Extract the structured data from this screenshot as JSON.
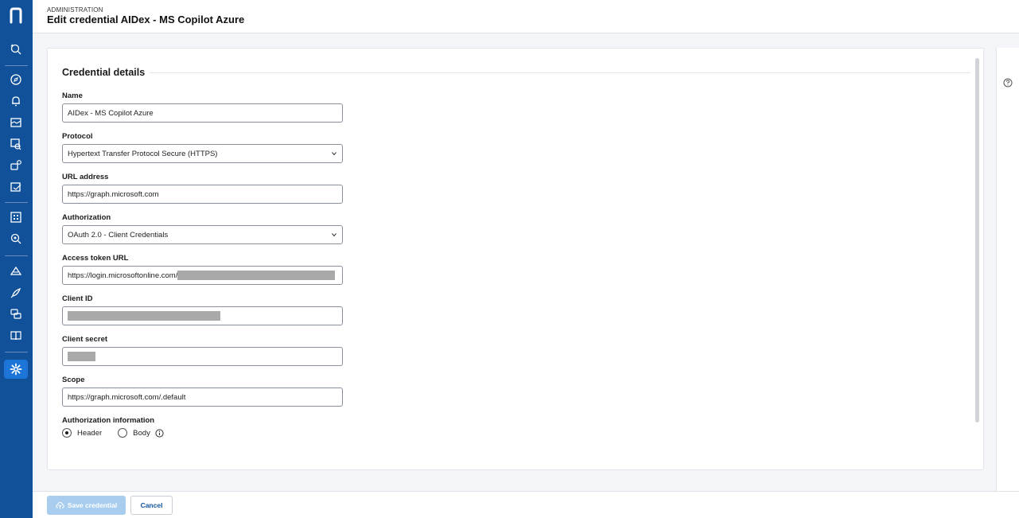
{
  "header": {
    "breadcrumb": "ADMINISTRATION",
    "title": "Edit credential AIDex - MS Copilot Azure"
  },
  "sidebar": {
    "items": [
      {
        "name": "search-icon"
      },
      {
        "name": "compass-icon"
      },
      {
        "name": "bell-icon"
      },
      {
        "name": "dashboard-icon"
      },
      {
        "name": "analysis-icon"
      },
      {
        "name": "integration-icon"
      },
      {
        "name": "report-icon"
      },
      {
        "name": "apps-icon"
      },
      {
        "name": "discovery-icon"
      },
      {
        "name": "deploy-icon"
      },
      {
        "name": "rocket-icon"
      },
      {
        "name": "chat-icon"
      },
      {
        "name": "book-icon"
      },
      {
        "name": "settings-icon"
      }
    ],
    "active_item": "settings-icon"
  },
  "form": {
    "section_title": "Credential details",
    "name_label": "Name",
    "name_value": "AIDex - MS Copilot Azure",
    "protocol_label": "Protocol",
    "protocol_value": "Hypertext Transfer Protocol Secure (HTTPS)",
    "url_label": "URL address",
    "url_value": "https://graph.microsoft.com",
    "auth_label": "Authorization",
    "auth_value": "OAuth 2.0 - Client Credentials",
    "token_url_label": "Access token URL",
    "token_url_value": "https://login.microsoftonline.com/",
    "client_id_label": "Client ID",
    "client_secret_label": "Client secret",
    "scope_label": "Scope",
    "scope_value": "https://graph.microsoft.com/.default",
    "auth_info_label": "Authorization information",
    "auth_info_options": [
      "Header",
      "Body"
    ],
    "auth_info_selected": "Header"
  },
  "footer": {
    "save_label": "Save credential",
    "cancel_label": "Cancel"
  },
  "colors": {
    "sidebar": "#11519a",
    "active": "#1d75d8",
    "save_disabled": "#a8cdee"
  }
}
